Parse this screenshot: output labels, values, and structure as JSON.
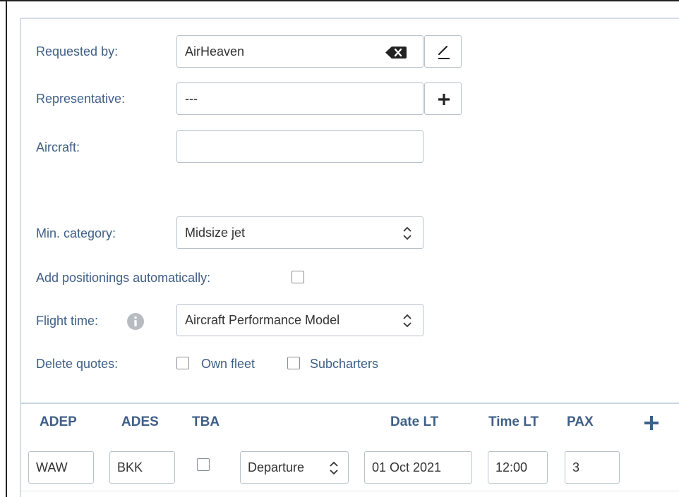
{
  "form": {
    "requested_by": {
      "label": "Requested by:",
      "value": "AirHeaven"
    },
    "representative": {
      "label": "Representative:",
      "value": "---"
    },
    "aircraft": {
      "label": "Aircraft:",
      "value": ""
    },
    "min_category": {
      "label": "Min. category:",
      "selected": "Midsize jet"
    },
    "add_positionings": {
      "label": "Add positionings automatically:",
      "checked": false
    },
    "flight_time": {
      "label": "Flight time:",
      "selected": "Aircraft Performance Model"
    },
    "delete_quotes": {
      "label": "Delete quotes:",
      "options": [
        {
          "label": "Own fleet",
          "checked": false
        },
        {
          "label": "Subcharters",
          "checked": false
        }
      ]
    }
  },
  "legs_table": {
    "headers": [
      "ADEP",
      "ADES",
      "TBA",
      "Date LT",
      "Time LT",
      "PAX"
    ],
    "rows": [
      {
        "adep": "WAW",
        "ades": "BKK",
        "tba": false,
        "type": "Departure",
        "date": "01 Oct 2021",
        "time": "12:00",
        "pax": "3"
      }
    ]
  },
  "colors": {
    "label": "#3f5f86",
    "border": "#b9c2cb",
    "divider": "#c9d4de",
    "icon": "#222222",
    "info_icon": "#b7bcc1"
  },
  "icons": [
    "clear-icon",
    "edit-icon",
    "plus-icon",
    "updown-icon",
    "info-icon",
    "add-leg-icon"
  ]
}
